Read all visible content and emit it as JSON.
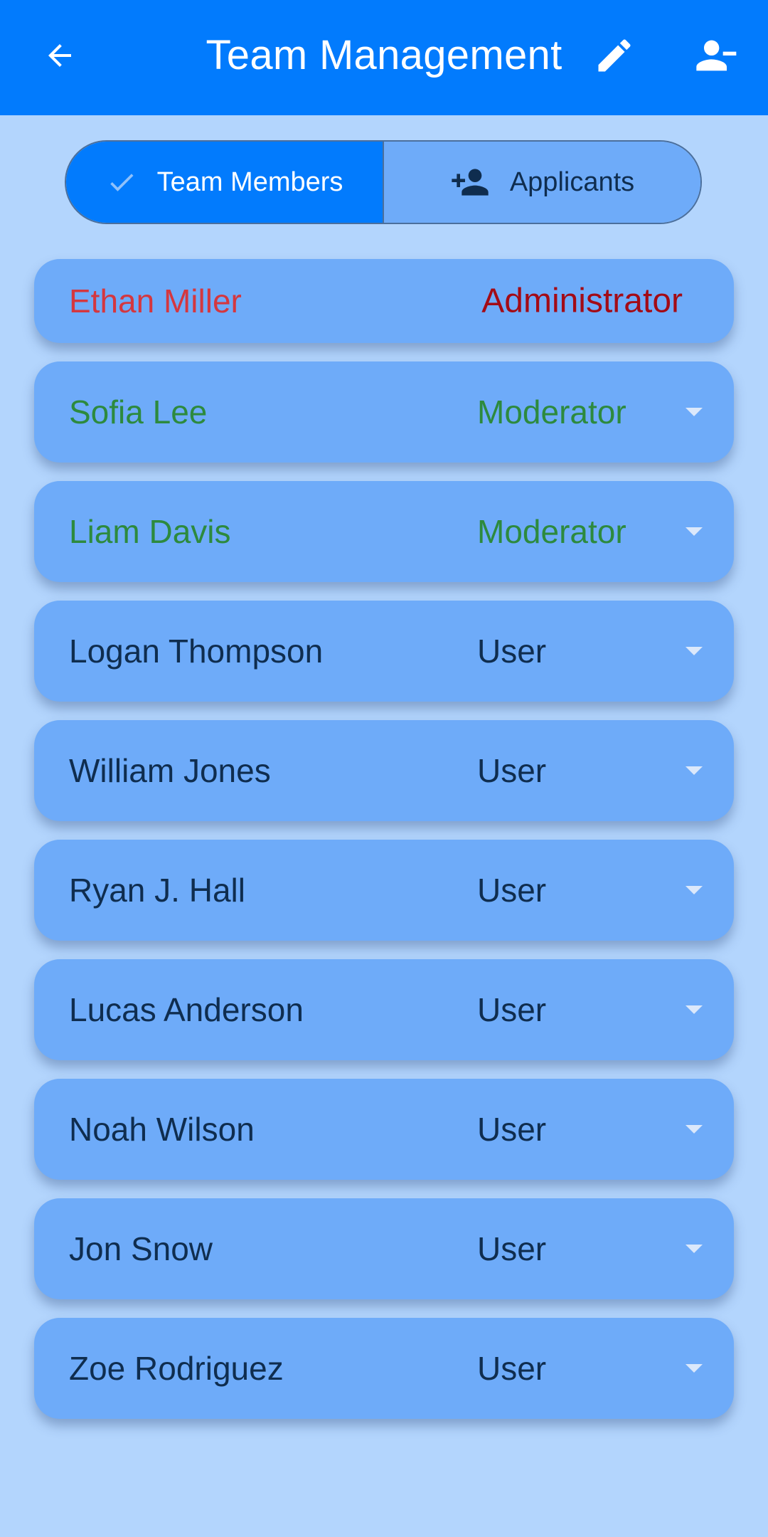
{
  "colors": {
    "app_bar": "#027bfd",
    "background": "#b3d5fd",
    "card": "#6eabf9",
    "admin_name": "#d4373f",
    "admin_role": "#a30b16",
    "moderator": "#2d8a3e",
    "user": "#0f2d4f"
  },
  "header": {
    "title": "Team Management",
    "back_icon": "arrow-back-icon",
    "edit_icon": "pencil-icon",
    "remove_user_icon": "person-remove-icon"
  },
  "tabs": [
    {
      "label": "Team Members",
      "icon": "check-icon",
      "selected": true
    },
    {
      "label": "Applicants",
      "icon": "person-add-icon",
      "selected": false
    }
  ],
  "members": [
    {
      "name": "Ethan Miller",
      "role": "Administrator"
    },
    {
      "name": "Sofia Lee",
      "role": "Moderator"
    },
    {
      "name": "Liam Davis",
      "role": "Moderator"
    },
    {
      "name": "Logan Thompson",
      "role": "User"
    },
    {
      "name": "William Jones",
      "role": "User"
    },
    {
      "name": "Ryan J. Hall",
      "role": "User"
    },
    {
      "name": "Lucas Anderson",
      "role": "User"
    },
    {
      "name": "Noah Wilson",
      "role": "User"
    },
    {
      "name": "Jon Snow",
      "role": "User"
    },
    {
      "name": "Zoe Rodriguez",
      "role": "User"
    }
  ]
}
